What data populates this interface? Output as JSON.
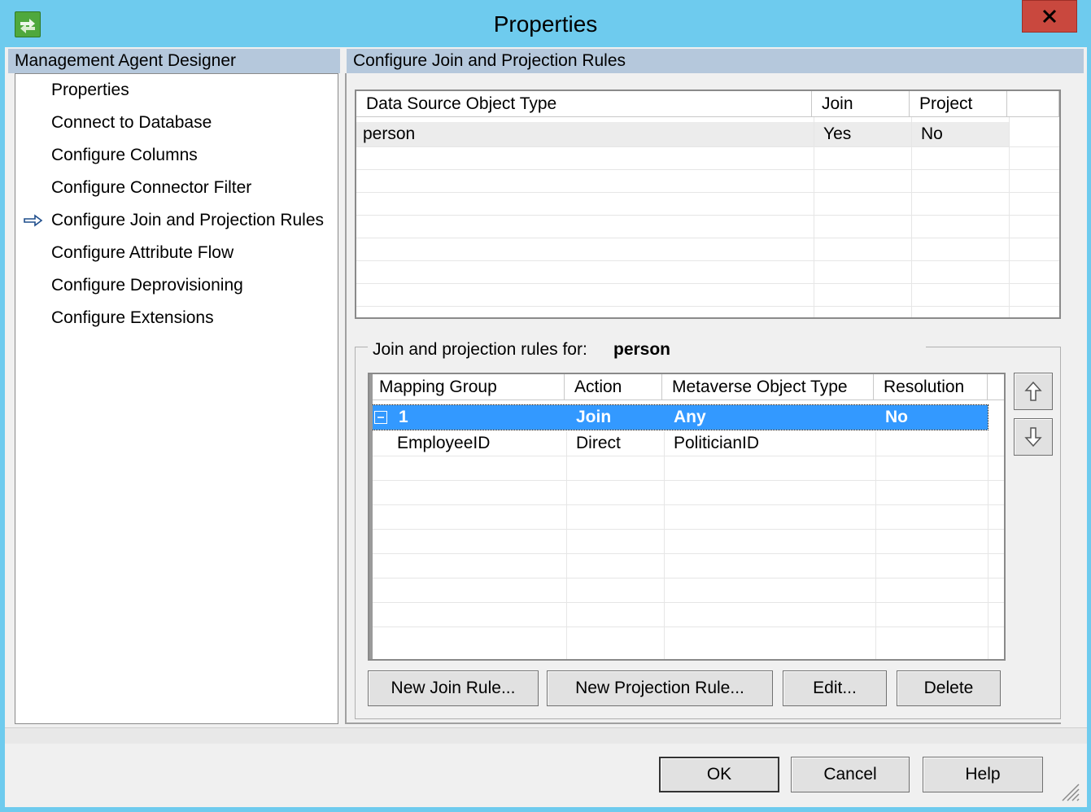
{
  "window": {
    "title": "Properties"
  },
  "left_panel": {
    "header": "Management Agent Designer",
    "items": [
      {
        "label": "Properties",
        "selected": false
      },
      {
        "label": "Connect to Database",
        "selected": false
      },
      {
        "label": "Configure Columns",
        "selected": false
      },
      {
        "label": "Configure Connector Filter",
        "selected": false
      },
      {
        "label": "Configure Join and Projection Rules",
        "selected": true
      },
      {
        "label": "Configure Attribute Flow",
        "selected": false
      },
      {
        "label": "Configure Deprovisioning",
        "selected": false
      },
      {
        "label": "Configure Extensions",
        "selected": false
      }
    ]
  },
  "right_panel": {
    "header": "Configure Join and Projection Rules",
    "object_types": {
      "columns": [
        "Data Source Object Type",
        "Join",
        "Project"
      ],
      "rows": [
        [
          "person",
          "Yes",
          "No"
        ]
      ]
    },
    "rules": {
      "label": "Join and projection rules for:",
      "object": "person",
      "columns": [
        "Mapping Group",
        "Action",
        "Metaverse Object Type",
        "Resolution"
      ],
      "group_row": {
        "expander": "⊟",
        "group": "1",
        "action": "Join",
        "metaverse": "Any",
        "resolution": "No"
      },
      "rows": [
        [
          "EmployeeID",
          "Direct",
          "PoliticianID",
          ""
        ]
      ]
    },
    "buttons": {
      "new_join": "New Join Rule...",
      "new_projection": "New Projection Rule...",
      "edit": "Edit...",
      "delete": "Delete"
    }
  },
  "footer": {
    "ok": "OK",
    "cancel": "Cancel",
    "help": "Help"
  },
  "colors": {
    "selection": "#3399ff",
    "header_band": "#b5c8dc",
    "titlebar": "#6ecbee",
    "close": "#c9483e"
  }
}
